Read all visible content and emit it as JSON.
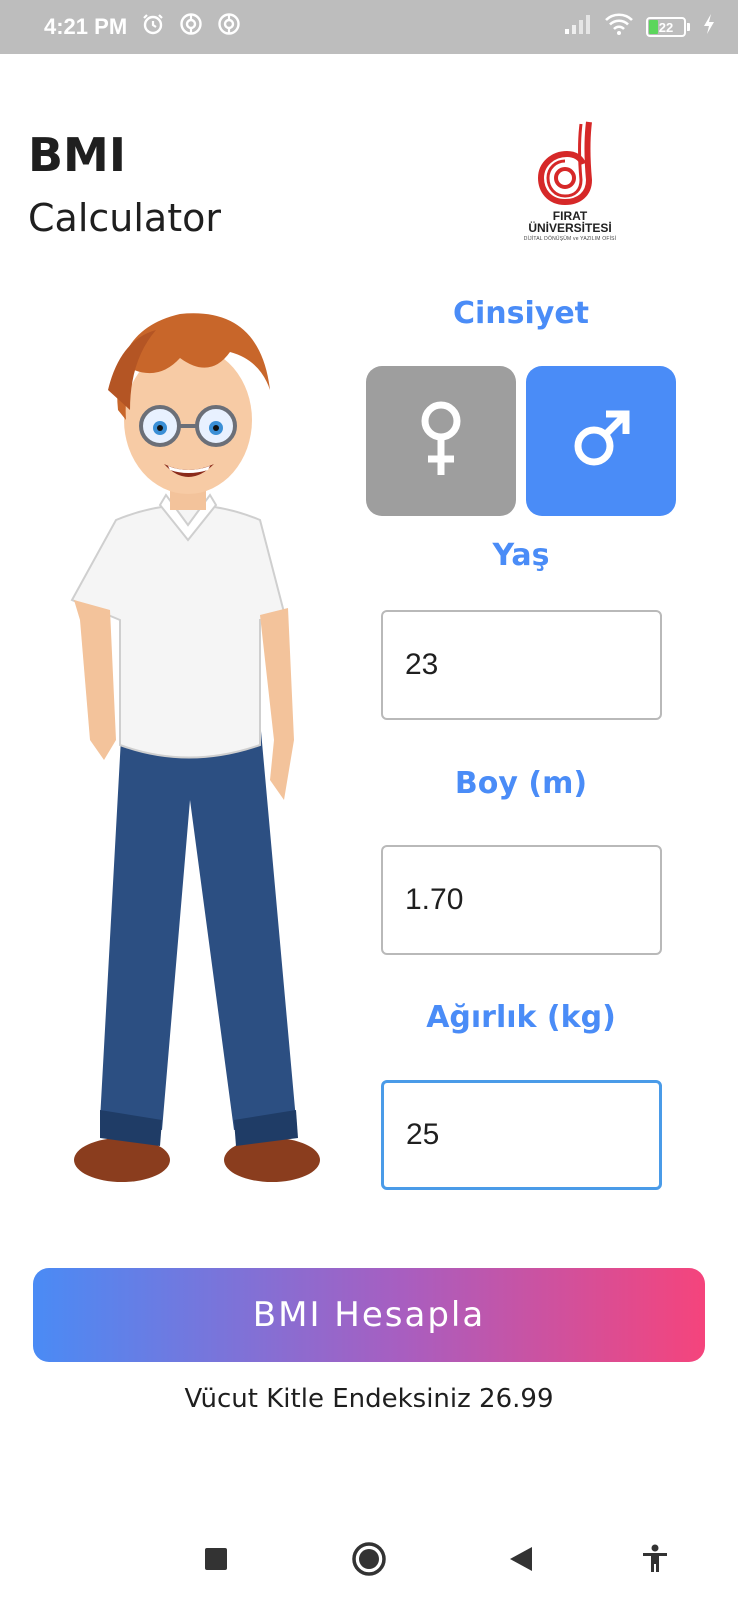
{
  "status_bar": {
    "time": "4:21 PM",
    "battery_level": "22",
    "icons": [
      "alarm-icon",
      "sync-icon",
      "sync-icon",
      "signal-icon",
      "wifi-icon",
      "battery-icon",
      "charging-icon"
    ]
  },
  "header": {
    "title": "BMI",
    "subtitle": "Calculator",
    "logo_text": "FIRAT ÜNİVERSİTESİ",
    "logo_subtext": "DİJİTAL DÖNÜŞÜM ve YAZILIM OFİSİ",
    "logo_color": "#d62828"
  },
  "gender": {
    "label": "Cinsiyet",
    "options": [
      {
        "name": "female",
        "icon": "female-icon",
        "selected": false
      },
      {
        "name": "male",
        "icon": "male-icon",
        "selected": true
      }
    ]
  },
  "age": {
    "label": "Yaş",
    "value": "23"
  },
  "height": {
    "label": "Boy (m)",
    "value": "1.70"
  },
  "weight": {
    "label": "Ağırlık (kg)",
    "value": "25"
  },
  "calculate_button": {
    "label": "BMI Hesapla"
  },
  "result": {
    "text": "Vücut Kitle Endeksiniz 26.99"
  },
  "colors": {
    "accent": "#4a8cf7",
    "inactive": "#9e9e9e",
    "gradient_start": "#4a8bf5",
    "gradient_end": "#f5447c"
  },
  "nav_bar": {
    "icons": [
      "square-icon",
      "home-circle-icon",
      "back-triangle-icon",
      "accessibility-icon"
    ]
  }
}
